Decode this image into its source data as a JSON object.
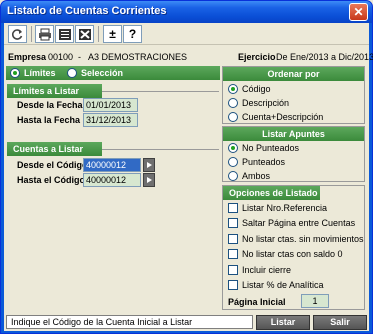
{
  "window": {
    "title": "Listado de Cuentas Corrientes",
    "close_glyph": "✕"
  },
  "toolbar": {
    "buttons": [
      {
        "name": "refresh-icon"
      },
      {
        "name": "print-icon"
      },
      {
        "name": "preview-icon"
      },
      {
        "name": "excel-icon"
      },
      {
        "name": "plus-minus-icon",
        "glyph": "±"
      },
      {
        "name": "help-icon",
        "glyph": "?"
      }
    ]
  },
  "header": {
    "empresa_label": "Empresa",
    "empresa_code": "00100",
    "empresa_sep": "-",
    "empresa_name": "A3 DEMOSTRACIONES",
    "ejercicio_label": "Ejercicio",
    "ejercicio_value": "De Ene/2013 a Dic/2013"
  },
  "mode": {
    "limites": "Límites",
    "seleccion": "Selección"
  },
  "limites": {
    "title": "Límites a Listar",
    "desde_fecha_label": "Desde la Fecha",
    "desde_fecha_value": "01/01/2013",
    "hasta_fecha_label": "Hasta la Fecha",
    "hasta_fecha_value": "31/12/2013"
  },
  "cuentas": {
    "title": "Cuentas a Listar",
    "desde_label": "Desde el Código",
    "desde_value": "40000012",
    "hasta_label": "Hasta el Código",
    "hasta_value": "40000012"
  },
  "ordenar": {
    "title": "Ordenar por",
    "options": [
      "Código",
      "Descripción",
      "Cuenta+Descripción"
    ],
    "selected": 0
  },
  "apuntes": {
    "title": "Listar Apuntes",
    "options": [
      "No Punteados",
      "Punteados",
      "Ambos"
    ],
    "selected": 0
  },
  "opciones": {
    "title": "Opciones de Listado",
    "items": [
      "Listar Nro.Referencia",
      "Saltar Página entre Cuentas",
      "No listar ctas. sin movimientos",
      "No listar ctas con saldo 0",
      "Incluir cierre",
      "Listar % de Analítica"
    ],
    "pagina_inicial_label": "Página Inicial",
    "pagina_inicial_value": "1"
  },
  "status": {
    "text": "Indique el Código de la Cuenta Inicial a Listar"
  },
  "buttons": {
    "listar": "Listar",
    "salir": "Salir"
  }
}
